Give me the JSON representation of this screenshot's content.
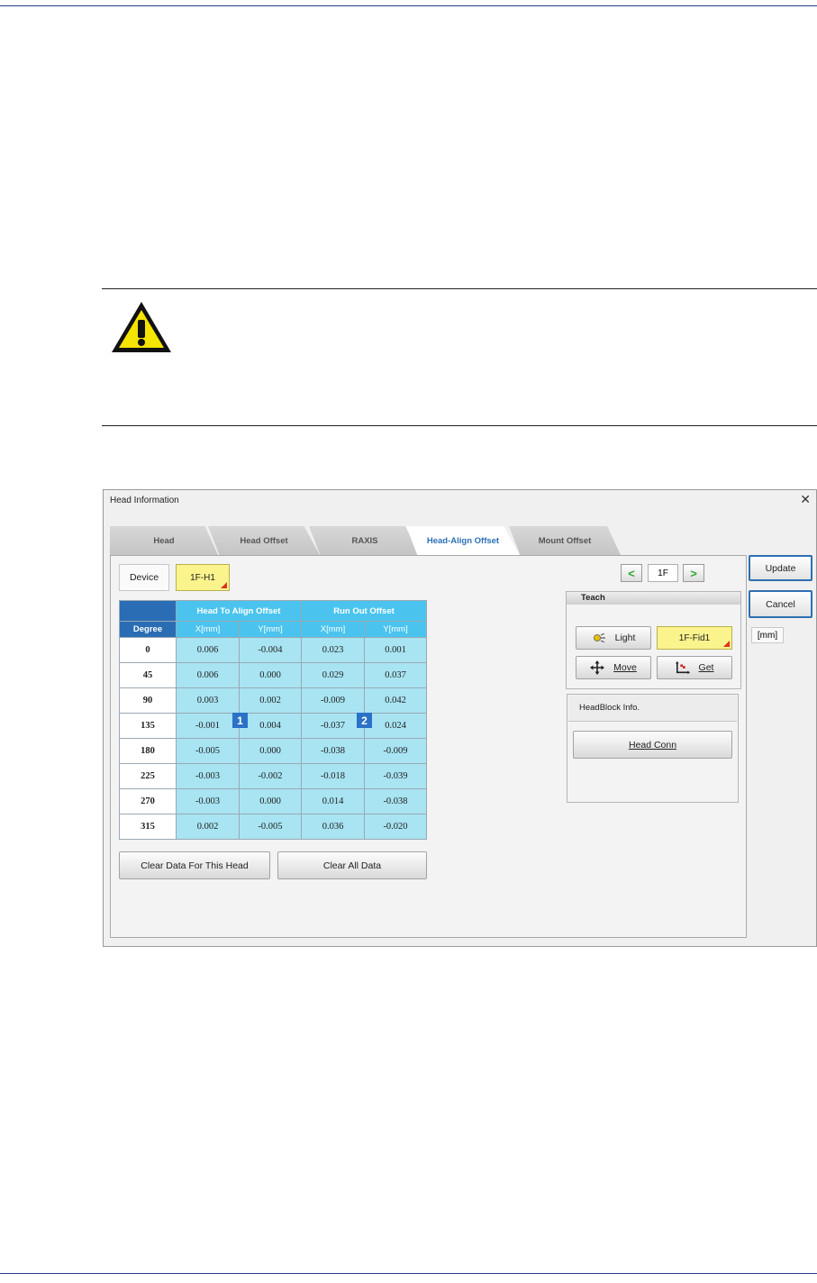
{
  "dialog": {
    "title": "Head Information",
    "close_glyph": "✕"
  },
  "tabs": [
    {
      "label": "Head",
      "active": false
    },
    {
      "label": "Head Offset",
      "active": false
    },
    {
      "label": "RAXIS",
      "active": false
    },
    {
      "label": "Head-Align Offset",
      "active": true
    },
    {
      "label": "Mount Offset",
      "active": false
    }
  ],
  "device": {
    "label": "Device",
    "value": "1F-H1"
  },
  "table": {
    "group_headers": [
      "Head To Align Offset",
      "Run Out Offset"
    ],
    "col_headers": [
      "Degree",
      "X[mm]",
      "Y[mm]",
      "X[mm]",
      "Y[mm]"
    ],
    "rows": [
      [
        "0",
        "0.006",
        "-0.004",
        "0.023",
        "0.001"
      ],
      [
        "45",
        "0.006",
        "0.000",
        "0.029",
        "0.037"
      ],
      [
        "90",
        "0.003",
        "0.002",
        "-0.009",
        "0.042"
      ],
      [
        "135",
        "-0.001",
        "0.004",
        "-0.037",
        "0.024"
      ],
      [
        "180",
        "-0.005",
        "0.000",
        "-0.038",
        "-0.009"
      ],
      [
        "225",
        "-0.003",
        "-0.002",
        "-0.018",
        "-0.039"
      ],
      [
        "270",
        "-0.003",
        "0.000",
        "0.014",
        "-0.038"
      ],
      [
        "315",
        "0.002",
        "-0.005",
        "0.036",
        "-0.020"
      ]
    ],
    "badges": [
      "1",
      "2"
    ]
  },
  "buttons": {
    "clear_head": "Clear Data For This Head",
    "clear_all": "Clear All Data",
    "update": "Update",
    "cancel": "Cancel"
  },
  "unit": "[mm]",
  "floor": {
    "value": "1F",
    "prev_glyph": "<",
    "next_glyph": ">"
  },
  "teach": {
    "title": "Teach",
    "light": "Light",
    "fid": "1F-Fid1",
    "move": "Move",
    "get": "Get"
  },
  "headblock": {
    "title": "HeadBlock Info.",
    "conn": "Head Conn"
  },
  "colors": {
    "accent": "#2a6fb8",
    "header_cyan": "#4ac4ee",
    "cell_cyan": "#a8e4f2",
    "yellow": "#fbf48c"
  }
}
